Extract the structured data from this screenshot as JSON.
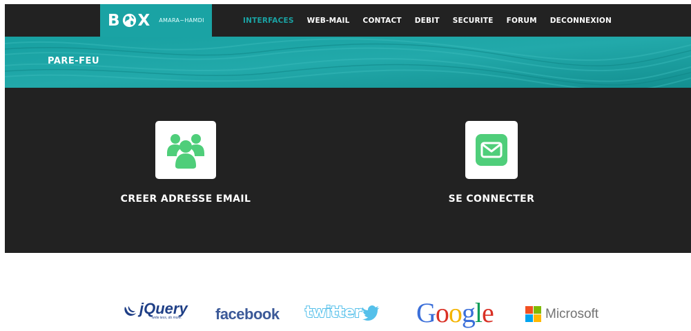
{
  "brand": {
    "logo": "B☻X",
    "logo_left": "B",
    "logo_right": "X",
    "subtitle": "AMARA~HAMDI"
  },
  "nav": [
    {
      "label": "INTERFACES",
      "active": true
    },
    {
      "label": "WEB-MAIL",
      "active": false
    },
    {
      "label": "CONTACT",
      "active": false
    },
    {
      "label": "DEBIT",
      "active": false
    },
    {
      "label": "SECURITE",
      "active": false
    },
    {
      "label": "FORUM",
      "active": false
    },
    {
      "label": "DECONNEXION",
      "active": false
    }
  ],
  "banner": {
    "title": "PARE-FEU"
  },
  "actions": {
    "create": {
      "label": "CREER ADRESSE EMAIL",
      "icon": "users-group-icon"
    },
    "login": {
      "label": "SE CONNECTER",
      "icon": "envelope-icon"
    }
  },
  "partners": {
    "jquery": "jQuery",
    "jquery_tagline": "write less, do more.",
    "facebook": "facebook",
    "twitter": "twitter",
    "google": [
      "G",
      "o",
      "o",
      "g",
      "l",
      "e"
    ],
    "microsoft": "Microsoft"
  },
  "colors": {
    "accent": "#1aa3a4",
    "dark": "#222222",
    "icon_green": "#4fce7a"
  }
}
